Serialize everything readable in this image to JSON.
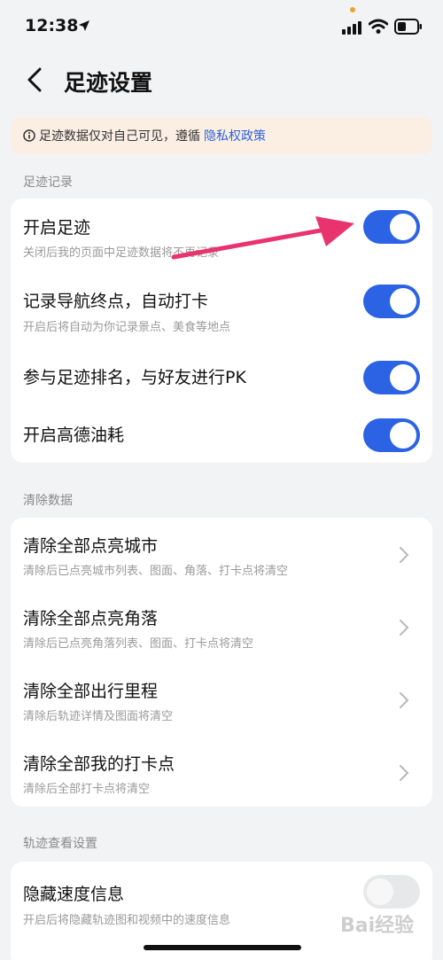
{
  "status_bar": {
    "time": "12:38"
  },
  "nav": {
    "title": "足迹设置"
  },
  "notice": {
    "text": "足迹数据仅对自己可见，遵循",
    "link": "隐私权政策"
  },
  "sections": {
    "footprint": {
      "header": "足迹记录",
      "items": [
        {
          "title": "开启足迹",
          "subtitle": "关闭后我的页面中足迹数据将不再记录",
          "on": true
        },
        {
          "title": "记录导航终点，自动打卡",
          "subtitle": "开启后将自动为你记录景点、美食等地点",
          "on": true
        },
        {
          "title": "参与足迹排名，与好友进行PK",
          "subtitle": "",
          "on": true
        },
        {
          "title": "开启高德油耗",
          "subtitle": "",
          "on": true
        }
      ]
    },
    "clear": {
      "header": "清除数据",
      "items": [
        {
          "title": "清除全部点亮城市",
          "subtitle": "清除后已点亮城市列表、图面、角落、打卡点将清空"
        },
        {
          "title": "清除全部点亮角落",
          "subtitle": "清除后已点亮角落列表、图面、打卡点将清空"
        },
        {
          "title": "清除全部出行里程",
          "subtitle": "清除后轨迹详情及图面将清空"
        },
        {
          "title": "清除全部我的打卡点",
          "subtitle": "清除后全部打卡点将清空"
        }
      ]
    },
    "track": {
      "header": "轨迹查看设置",
      "items": [
        {
          "title": "隐藏速度信息",
          "subtitle": "开启后将隐藏轨迹图和视频中的速度信息",
          "on": false
        }
      ]
    }
  },
  "watermark": "Bai经验",
  "colors": {
    "accent": "#2b63e4",
    "background": "#f2f3f5",
    "notice_bg": "#fbeee3",
    "annotation_arrow": "#e8336f"
  }
}
